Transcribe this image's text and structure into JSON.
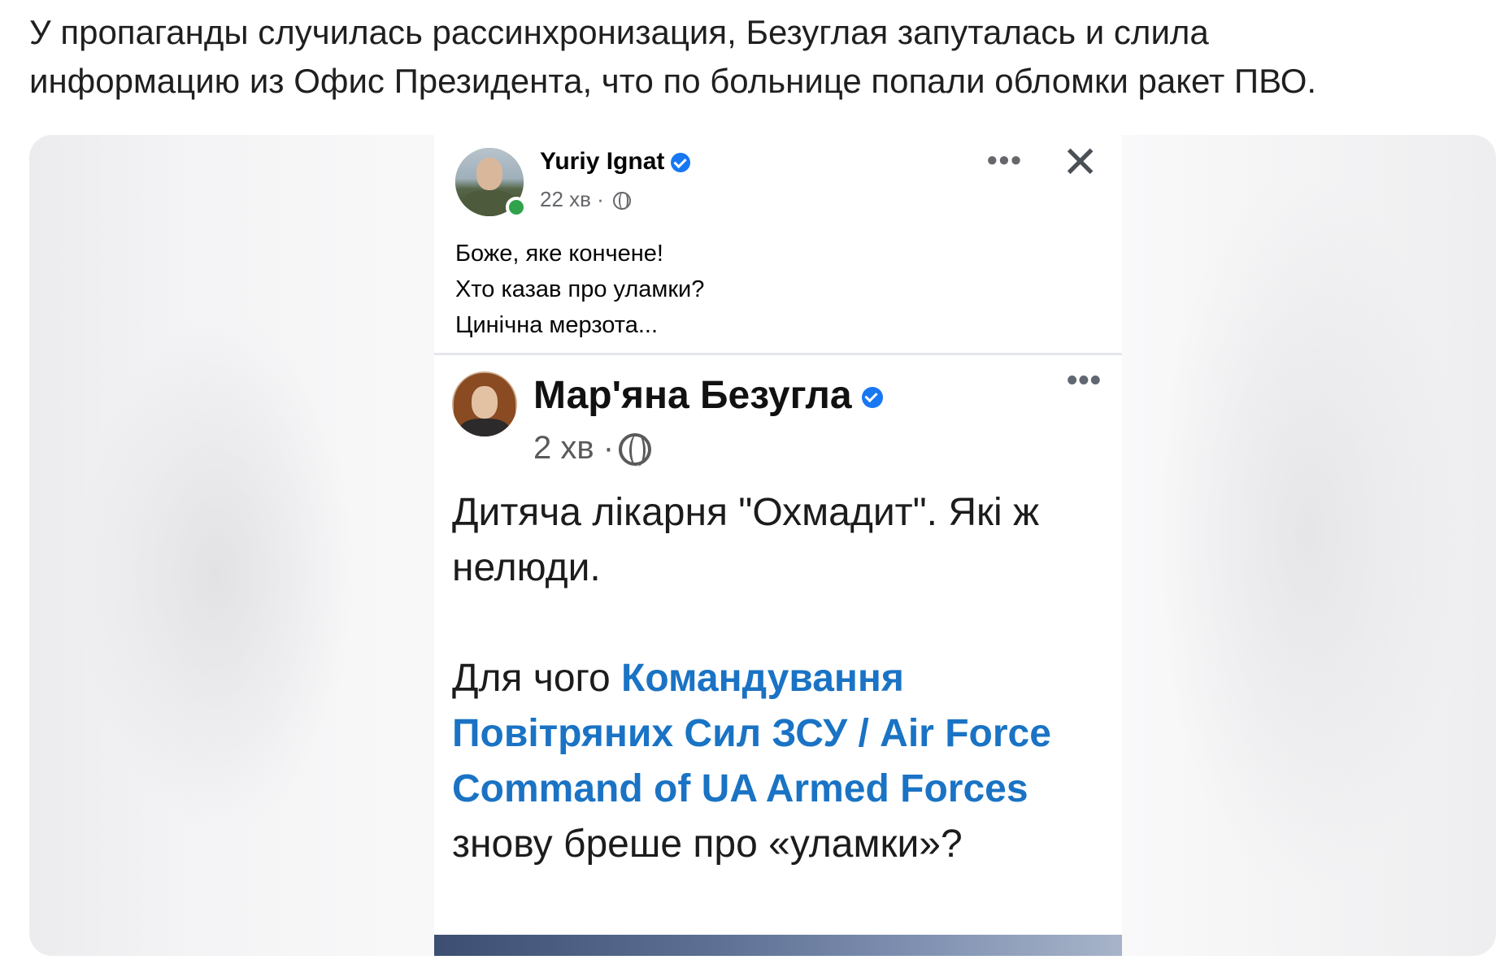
{
  "caption": {
    "line1": "У пропаганды случилась рассинхронизация, Безуглая запуталась и слила",
    "line2": "информацию из Офис Президента, что по больнице попали обломки ракет ПВО."
  },
  "post1": {
    "author": "Yuriy Ignat",
    "time": "22 хв ·",
    "more_icon": "more-horizontal-icon",
    "close_icon": "close-icon",
    "lines": [
      "Боже, яке кончене!",
      "Хто казав про уламки?",
      "Цинічна мерзота..."
    ]
  },
  "post2": {
    "author": "Мар'яна Безугла",
    "time": "2 хв ·",
    "more_icon": "more-horizontal-icon",
    "text_before": "Дитяча лікарня \"Охмадит\". Які ж нелюди.",
    "text_prefix": "Для чого ",
    "link_text": "Командування Повітряних Сил ЗСУ / Air Force Command of UA Armed Forces",
    "text_suffix": " знову бреше про «уламки»?"
  },
  "colors": {
    "verified": "#1877f2",
    "online": "#31a24c",
    "link": "#1a73c4"
  }
}
